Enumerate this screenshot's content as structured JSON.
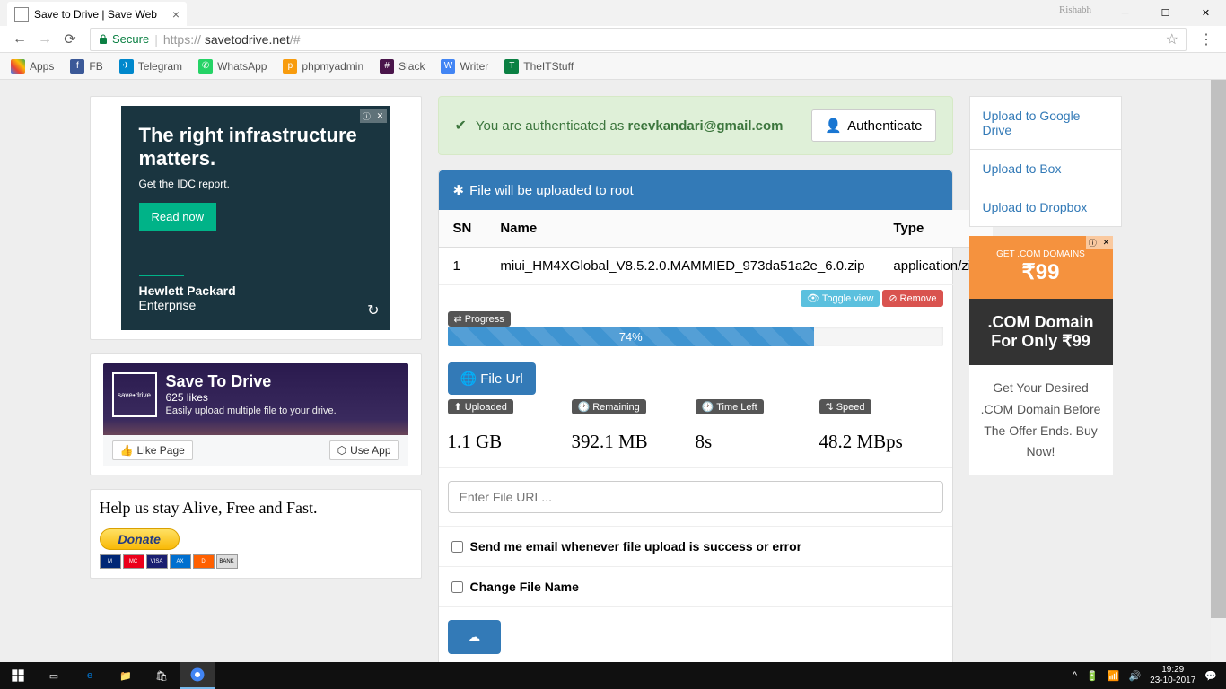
{
  "browser": {
    "tab_title": "Save to Drive | Save Web",
    "user": "Rishabh",
    "url_secure": "Secure",
    "url_host": "https://",
    "url_domain": "savetodrive.net",
    "url_path": "/#"
  },
  "bookmarks": {
    "apps": "Apps",
    "items": [
      {
        "label": "FB",
        "color": "#3b5998"
      },
      {
        "label": "Telegram",
        "color": "#0088cc"
      },
      {
        "label": "WhatsApp",
        "color": "#25d366"
      },
      {
        "label": "phpmyadmin",
        "color": "#f89c0e"
      },
      {
        "label": "Slack",
        "color": "#4a154b"
      },
      {
        "label": "Writer",
        "color": "#4285f4"
      },
      {
        "label": "TheITStuff",
        "color": "#0b8043"
      }
    ]
  },
  "ad_hpe": {
    "title": "The right infrastructure matters.",
    "subtitle": "Get the IDC report.",
    "cta": "Read now",
    "brand1": "Hewlett Packard",
    "brand2": "Enterprise"
  },
  "fb": {
    "title": "Save To Drive",
    "likes": "625 likes",
    "sub": "Easily upload multiple file to your drive.",
    "like": "Like Page",
    "use": "Use App",
    "logo": "save•drive"
  },
  "donate": {
    "heading": "Help us stay Alive, Free and Fast.",
    "btn": "Donate"
  },
  "auth": {
    "prefix": "You are authenticated as ",
    "email": "reevkandari@gmail.com",
    "btn": "Authenticate"
  },
  "upload": {
    "header": "File will be uploaded to root",
    "table": {
      "cols": [
        "SN",
        "Name",
        "Type"
      ],
      "row": {
        "sn": "1",
        "name": "miui_HM4XGlobal_V8.5.2.0.MAMMIED_973da51a2e_6.0.zip",
        "type": "application/zip"
      }
    },
    "progress_label": "Progress",
    "toggle": "Toggle view",
    "remove": "Remove",
    "progress_pct": "74%",
    "progress_width": 74,
    "file_url_btn": "File Url",
    "stats": {
      "uploaded": {
        "label": "Uploaded",
        "value": "1.1 GB"
      },
      "remaining": {
        "label": "Remaining",
        "value": "392.1 MB"
      },
      "timeleft": {
        "label": "Time Left",
        "value": "8s"
      },
      "speed": {
        "label": "Speed",
        "value": "48.2 MBps"
      }
    },
    "url_placeholder": "Enter File URL...",
    "email_check": "Send me email whenever file upload is success or error",
    "rename_check": "Change File Name"
  },
  "right_links": [
    "Upload to Google Drive",
    "Upload to Box",
    "Upload to Dropbox"
  ],
  "ad_right": {
    "top1": "GET .COM DOMAINS",
    "price": "₹99",
    "mid": ".COM Domain For Only ₹99",
    "text": "Get Your Desired .COM Domain Before The Offer Ends. Buy Now!"
  },
  "taskbar": {
    "time": "19:29",
    "date": "23-10-2017"
  }
}
